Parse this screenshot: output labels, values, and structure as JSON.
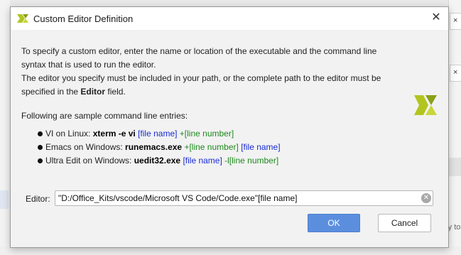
{
  "dialog": {
    "title": "Custom Editor Definition",
    "close_glyph": "✕",
    "intro_line1": "To specify a custom editor, enter the name or location of the executable and the command line",
    "intro_line2": "syntax that is used to run the editor.",
    "path_line1": "The editor you specify must be included in your path, or the complete path to the editor must be",
    "path_line2_prefix": "specified in the ",
    "path_line2_bold": "Editor",
    "path_line2_suffix": " field.",
    "samples_heading": "Following are sample command line entries:",
    "samples": [
      {
        "prefix": "VI on Linux: ",
        "command": "xterm -e vi",
        "file": "[file name]",
        "line": "+[line number]"
      },
      {
        "prefix": "Emacs on Windows: ",
        "command": "runemacs.exe",
        "line": "+[line number]",
        "file": "[file name]"
      },
      {
        "prefix": "Ultra Edit on Windows: ",
        "command": "uedit32.exe",
        "file": "[file name]",
        "line": "-l[line number]"
      }
    ],
    "editor_label": "Editor:",
    "editor_value": "\"D:/Office_Kits/vscode/Microsoft VS Code/Code.exe\"[file name]",
    "ok_label": "OK",
    "cancel_label": "Cancel"
  },
  "background": {
    "tab_glyph": "×",
    "partial_text": "ry to"
  },
  "colors": {
    "ok_button": "#5b8fde",
    "file_token": "#1a2bd6",
    "line_token": "#1e8a1e",
    "logo": "#b2c51f"
  },
  "icons": {
    "title_logo": "vivado-logo-icon",
    "large_logo": "vivado-logo-icon",
    "clear": "clear-field-icon",
    "bullet": "bullet-icon",
    "close": "close-icon"
  }
}
